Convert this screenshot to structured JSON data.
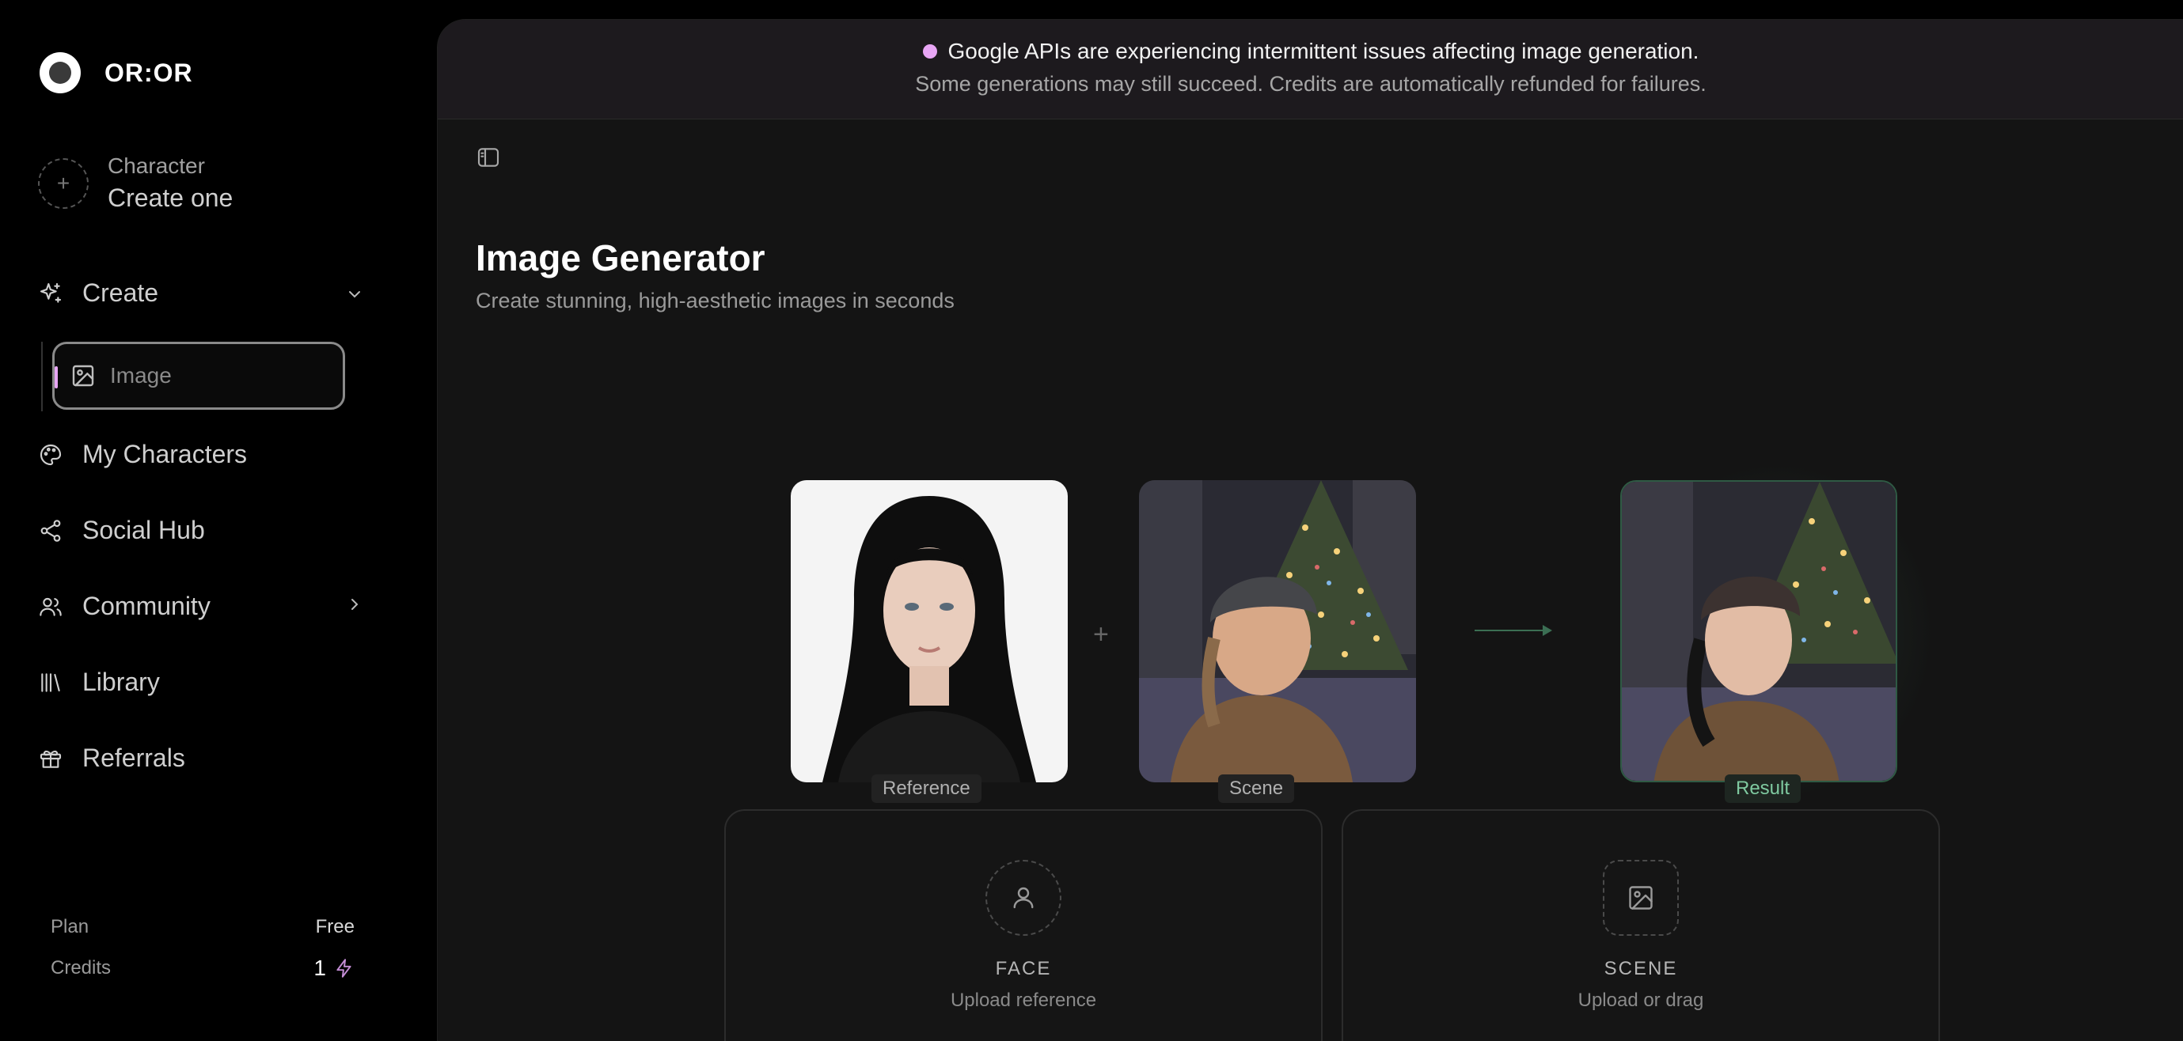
{
  "brand": {
    "name": "OR:OR"
  },
  "character": {
    "label": "Character",
    "action": "Create one"
  },
  "nav": {
    "create": "Create",
    "image": "Image",
    "my_characters": "My Characters",
    "social_hub": "Social Hub",
    "community": "Community",
    "library": "Library",
    "referrals": "Referrals"
  },
  "account": {
    "plan_label": "Plan",
    "plan_value": "Free",
    "credits_label": "Credits",
    "credits_value": "1"
  },
  "banner": {
    "line1": "Google APIs are experiencing intermittent issues affecting image generation.",
    "line2": "Some generations may still succeed. Credits are automatically refunded for failures."
  },
  "page": {
    "title": "Image Generator",
    "subtitle": "Create stunning, high-aesthetic images in seconds"
  },
  "preview": {
    "reference": "Reference",
    "scene": "Scene",
    "result": "Result",
    "plus": "+"
  },
  "upload": {
    "face_title": "FACE",
    "face_sub": "Upload reference",
    "scene_title": "SCENE",
    "scene_sub": "Upload or drag"
  },
  "colors": {
    "accent": "#e8a6f5",
    "result_green": "#7fc9a0",
    "background": "#141414"
  }
}
